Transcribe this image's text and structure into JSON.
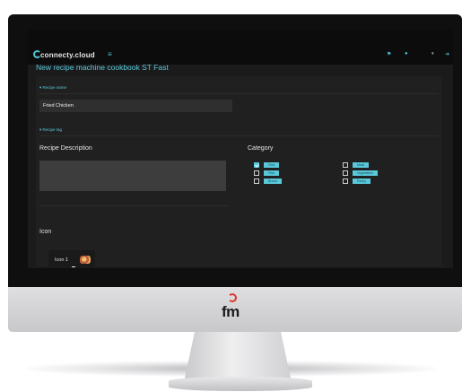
{
  "app": {
    "brand": "connecty.cloud",
    "menu_icon": "hamburger-icon",
    "toolbar_icons": [
      "flag-icon",
      "user-icon",
      "caret-down-icon",
      "logout-icon"
    ]
  },
  "page": {
    "title": "New recipe machine cookbook ST Fast"
  },
  "sections": {
    "recipe_name": "Recipe name",
    "recipe_tag": "Recipe tag"
  },
  "form": {
    "name_value": "Fried Chicken",
    "description_label": "Recipe Description",
    "description_value": "",
    "icon_label": "Icon",
    "icon_item": "Icon 1",
    "category_label": "Category"
  },
  "categories": [
    {
      "label": "First",
      "checked": true
    },
    {
      "label": "Fish",
      "checked": false
    },
    {
      "label": "Bread",
      "checked": false
    },
    {
      "label": "Meat",
      "checked": false
    },
    {
      "label": "Vegetables",
      "checked": false
    },
    {
      "label": "Pastry",
      "checked": false
    }
  ],
  "monitor": {
    "brand": "fm"
  },
  "colors": {
    "accent": "#58c8da",
    "background": "#1b1b1c",
    "brand_red": "#e0332c"
  }
}
